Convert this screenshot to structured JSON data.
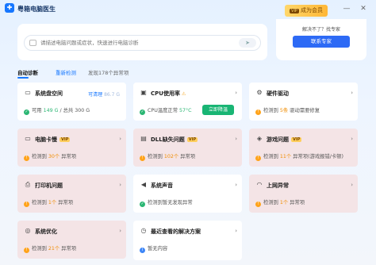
{
  "app": {
    "title": "粤箱电脑医生",
    "logo_icon": "app-logo-icon"
  },
  "header": {
    "vip_tag": "VIP",
    "vip_label": "成为会员",
    "minimize": "—",
    "close": "✕"
  },
  "search": {
    "placeholder": "请描述电脑问题或症状，快速进行电脑诊断",
    "send_icon": "send-icon"
  },
  "expert": {
    "text": "解决不了？找专家",
    "button": "联系专家"
  },
  "tabs": {
    "auto": "自动诊断",
    "rescan": "重新检测",
    "found": "发现178个异常项"
  },
  "cards": {
    "disk": {
      "title": "系统盘空间",
      "clean_label": "可清理",
      "clean_value": "86.7 G",
      "status_prefix": "可用",
      "free": "149 G",
      "status_suffix": " / 总共 300 G"
    },
    "cpu": {
      "title": "CPU使用率",
      "temp_label": "CPU温度正常",
      "temp_value": "57°C",
      "button": "立即降温"
    },
    "driver": {
      "title": "硬件驱动",
      "prefix": "检测到",
      "count": "5条",
      "suffix": "驱动需要修复"
    },
    "lag": {
      "title": "电脑卡慢",
      "vip": "VIP",
      "prefix": "检测到",
      "count": "30个",
      "suffix": "异常项"
    },
    "dll": {
      "title": "DLL缺失问题",
      "vip": "VIP",
      "prefix": "检测到",
      "count": "102个",
      "suffix": "异常项"
    },
    "game": {
      "title": "游戏问题",
      "vip": "VIP",
      "prefix": "检测到",
      "count": "11个",
      "suffix": "异常项(游戏报错/卡顿)"
    },
    "printer": {
      "title": "打印机问题",
      "prefix": "检测到",
      "count": "1个",
      "suffix": "异常项"
    },
    "sound": {
      "title": "系统声音",
      "status": "检测到暂无发现异常"
    },
    "network": {
      "title": "上网异常",
      "prefix": "检测到",
      "count": "1个",
      "suffix": "异常项"
    },
    "optimize": {
      "title": "系统优化",
      "prefix": "检测到",
      "count": "21个",
      "suffix": "异常项"
    },
    "recent": {
      "title": "最近查看的解决方案",
      "status": "暂无内容"
    }
  },
  "colors": {
    "accent": "#1677ff",
    "warning": "#f08c00",
    "success": "#2bb673",
    "alert_card": "#f4e4e6",
    "fix_button": "#19b574"
  }
}
